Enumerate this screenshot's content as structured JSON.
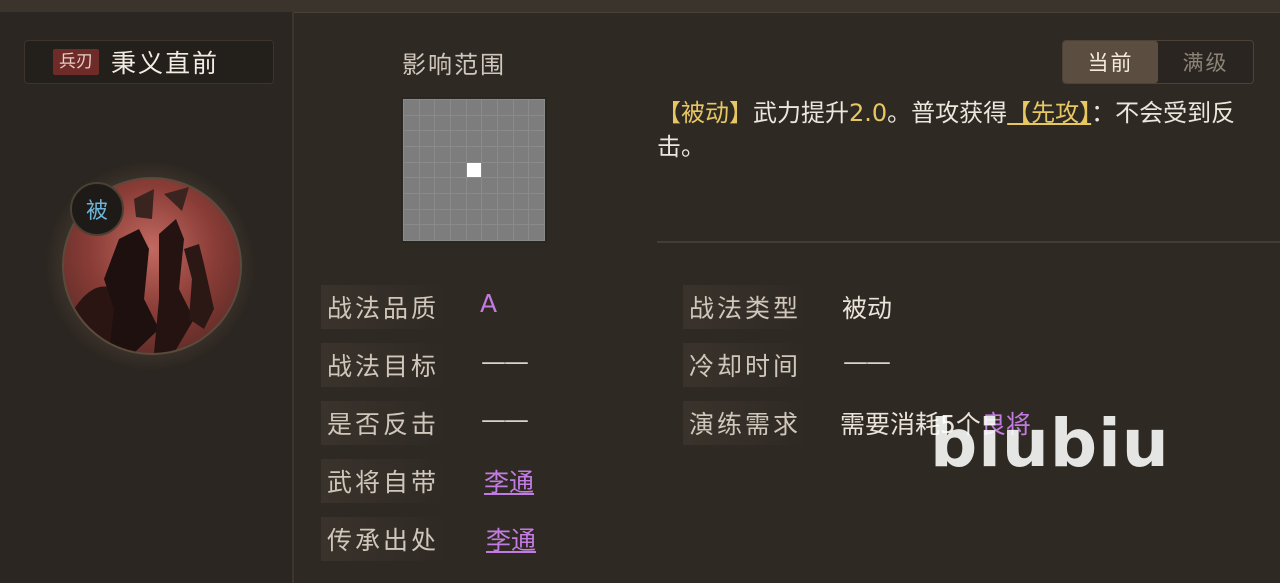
{
  "skill": {
    "type_tag": "兵刃",
    "name": "秉义直前"
  },
  "badge": "被",
  "range": {
    "title": "影响范围"
  },
  "tabs": {
    "current": "当前",
    "max": "满级"
  },
  "description": {
    "bracket_passive": "【被动】",
    "text1": "武力提升",
    "value": "2.0",
    "text2": "。普攻获得",
    "bracket_first": "【先攻】",
    "text3": "：不会受到反击。"
  },
  "left_rows": [
    {
      "label": "战法品质",
      "value": "A"
    },
    {
      "label": "战法目标",
      "value": "——"
    },
    {
      "label": "是否反击",
      "value": "——"
    },
    {
      "label": "武将自带",
      "value": "李通"
    },
    {
      "label": "传承出处",
      "value": "李通"
    }
  ],
  "right_rows": [
    {
      "label": "战法类型",
      "value": "被动"
    },
    {
      "label": "冷却时间",
      "value": "——"
    },
    {
      "label": "演练需求",
      "value_prefix": "需要消耗5个",
      "value_link": "良将"
    }
  ],
  "watermark": "biubiu",
  "colors": {
    "gold": "#e6c761",
    "purple": "#c27be0",
    "background": "#2f2924"
  }
}
